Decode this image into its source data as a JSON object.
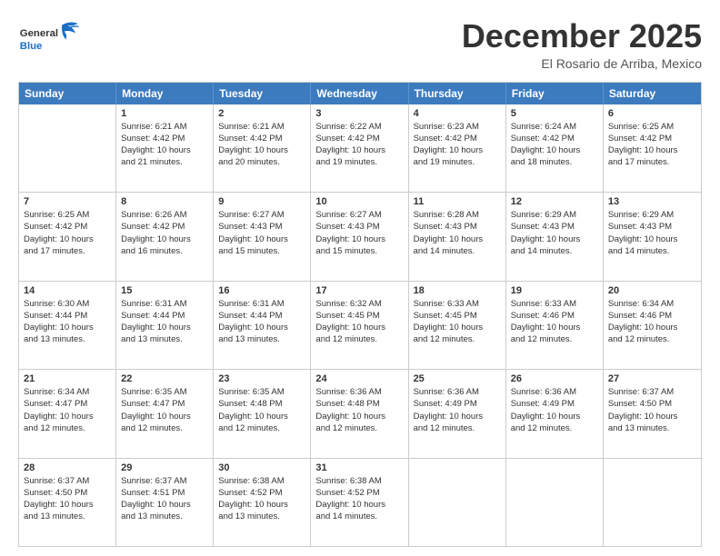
{
  "header": {
    "logo_general": "General",
    "logo_blue": "Blue",
    "month_title": "December 2025",
    "subtitle": "El Rosario de Arriba, Mexico"
  },
  "calendar": {
    "days_of_week": [
      "Sunday",
      "Monday",
      "Tuesday",
      "Wednesday",
      "Thursday",
      "Friday",
      "Saturday"
    ],
    "rows": [
      [
        {
          "day": "",
          "info": ""
        },
        {
          "day": "1",
          "info": "Sunrise: 6:21 AM\nSunset: 4:42 PM\nDaylight: 10 hours\nand 21 minutes."
        },
        {
          "day": "2",
          "info": "Sunrise: 6:21 AM\nSunset: 4:42 PM\nDaylight: 10 hours\nand 20 minutes."
        },
        {
          "day": "3",
          "info": "Sunrise: 6:22 AM\nSunset: 4:42 PM\nDaylight: 10 hours\nand 19 minutes."
        },
        {
          "day": "4",
          "info": "Sunrise: 6:23 AM\nSunset: 4:42 PM\nDaylight: 10 hours\nand 19 minutes."
        },
        {
          "day": "5",
          "info": "Sunrise: 6:24 AM\nSunset: 4:42 PM\nDaylight: 10 hours\nand 18 minutes."
        },
        {
          "day": "6",
          "info": "Sunrise: 6:25 AM\nSunset: 4:42 PM\nDaylight: 10 hours\nand 17 minutes."
        }
      ],
      [
        {
          "day": "7",
          "info": "Sunrise: 6:25 AM\nSunset: 4:42 PM\nDaylight: 10 hours\nand 17 minutes."
        },
        {
          "day": "8",
          "info": "Sunrise: 6:26 AM\nSunset: 4:42 PM\nDaylight: 10 hours\nand 16 minutes."
        },
        {
          "day": "9",
          "info": "Sunrise: 6:27 AM\nSunset: 4:43 PM\nDaylight: 10 hours\nand 15 minutes."
        },
        {
          "day": "10",
          "info": "Sunrise: 6:27 AM\nSunset: 4:43 PM\nDaylight: 10 hours\nand 15 minutes."
        },
        {
          "day": "11",
          "info": "Sunrise: 6:28 AM\nSunset: 4:43 PM\nDaylight: 10 hours\nand 14 minutes."
        },
        {
          "day": "12",
          "info": "Sunrise: 6:29 AM\nSunset: 4:43 PM\nDaylight: 10 hours\nand 14 minutes."
        },
        {
          "day": "13",
          "info": "Sunrise: 6:29 AM\nSunset: 4:43 PM\nDaylight: 10 hours\nand 14 minutes."
        }
      ],
      [
        {
          "day": "14",
          "info": "Sunrise: 6:30 AM\nSunset: 4:44 PM\nDaylight: 10 hours\nand 13 minutes."
        },
        {
          "day": "15",
          "info": "Sunrise: 6:31 AM\nSunset: 4:44 PM\nDaylight: 10 hours\nand 13 minutes."
        },
        {
          "day": "16",
          "info": "Sunrise: 6:31 AM\nSunset: 4:44 PM\nDaylight: 10 hours\nand 13 minutes."
        },
        {
          "day": "17",
          "info": "Sunrise: 6:32 AM\nSunset: 4:45 PM\nDaylight: 10 hours\nand 12 minutes."
        },
        {
          "day": "18",
          "info": "Sunrise: 6:33 AM\nSunset: 4:45 PM\nDaylight: 10 hours\nand 12 minutes."
        },
        {
          "day": "19",
          "info": "Sunrise: 6:33 AM\nSunset: 4:46 PM\nDaylight: 10 hours\nand 12 minutes."
        },
        {
          "day": "20",
          "info": "Sunrise: 6:34 AM\nSunset: 4:46 PM\nDaylight: 10 hours\nand 12 minutes."
        }
      ],
      [
        {
          "day": "21",
          "info": "Sunrise: 6:34 AM\nSunset: 4:47 PM\nDaylight: 10 hours\nand 12 minutes."
        },
        {
          "day": "22",
          "info": "Sunrise: 6:35 AM\nSunset: 4:47 PM\nDaylight: 10 hours\nand 12 minutes."
        },
        {
          "day": "23",
          "info": "Sunrise: 6:35 AM\nSunset: 4:48 PM\nDaylight: 10 hours\nand 12 minutes."
        },
        {
          "day": "24",
          "info": "Sunrise: 6:36 AM\nSunset: 4:48 PM\nDaylight: 10 hours\nand 12 minutes."
        },
        {
          "day": "25",
          "info": "Sunrise: 6:36 AM\nSunset: 4:49 PM\nDaylight: 10 hours\nand 12 minutes."
        },
        {
          "day": "26",
          "info": "Sunrise: 6:36 AM\nSunset: 4:49 PM\nDaylight: 10 hours\nand 12 minutes."
        },
        {
          "day": "27",
          "info": "Sunrise: 6:37 AM\nSunset: 4:50 PM\nDaylight: 10 hours\nand 13 minutes."
        }
      ],
      [
        {
          "day": "28",
          "info": "Sunrise: 6:37 AM\nSunset: 4:50 PM\nDaylight: 10 hours\nand 13 minutes."
        },
        {
          "day": "29",
          "info": "Sunrise: 6:37 AM\nSunset: 4:51 PM\nDaylight: 10 hours\nand 13 minutes."
        },
        {
          "day": "30",
          "info": "Sunrise: 6:38 AM\nSunset: 4:52 PM\nDaylight: 10 hours\nand 13 minutes."
        },
        {
          "day": "31",
          "info": "Sunrise: 6:38 AM\nSunset: 4:52 PM\nDaylight: 10 hours\nand 14 minutes."
        },
        {
          "day": "",
          "info": ""
        },
        {
          "day": "",
          "info": ""
        },
        {
          "day": "",
          "info": ""
        }
      ]
    ]
  }
}
